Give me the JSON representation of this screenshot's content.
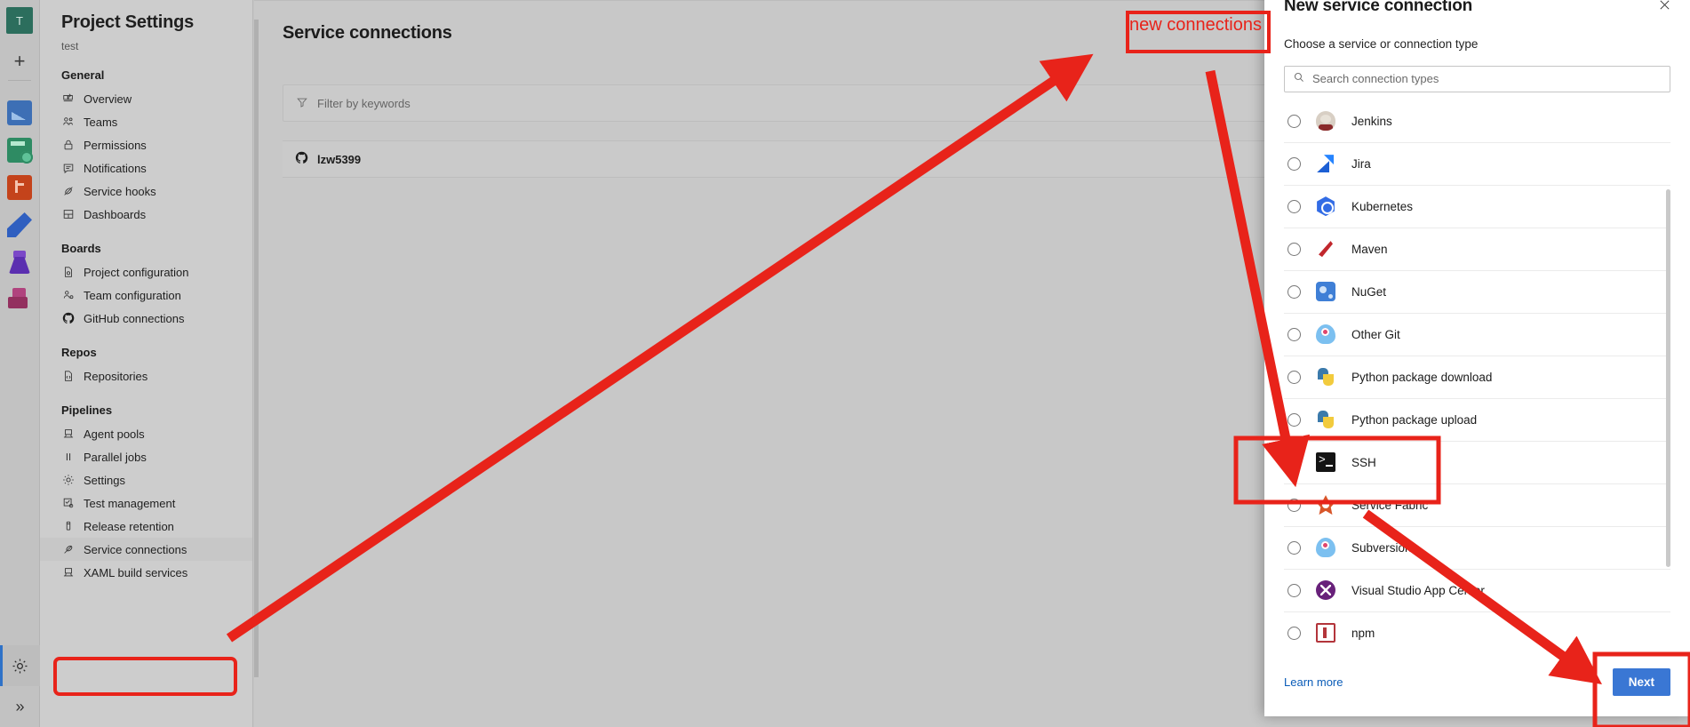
{
  "rail": {
    "org_initial": "T",
    "items": [
      {
        "name": "create-new-icon",
        "label": "+"
      },
      {
        "name": "overview-icon",
        "label": "Overview"
      },
      {
        "name": "boards-icon",
        "label": "Boards"
      },
      {
        "name": "repos-icon",
        "label": "Repos"
      },
      {
        "name": "pipelines-icon",
        "label": "Pipelines"
      },
      {
        "name": "test-plans-icon",
        "label": "Test Plans"
      },
      {
        "name": "artifacts-icon",
        "label": "Artifacts"
      }
    ],
    "settings_label": "Project settings",
    "expand_label": "Expand"
  },
  "nav": {
    "title": "Project Settings",
    "subtitle": "test",
    "groups": [
      {
        "label": "General",
        "items": [
          {
            "label": "Overview",
            "icon": "overview-icon"
          },
          {
            "label": "Teams",
            "icon": "teams-icon"
          },
          {
            "label": "Permissions",
            "icon": "lock-icon"
          },
          {
            "label": "Notifications",
            "icon": "notification-icon"
          },
          {
            "label": "Service hooks",
            "icon": "service-hooks-icon"
          },
          {
            "label": "Dashboards",
            "icon": "dashboards-icon"
          }
        ]
      },
      {
        "label": "Boards",
        "items": [
          {
            "label": "Project configuration",
            "icon": "project-configuration-icon"
          },
          {
            "label": "Team configuration",
            "icon": "team-configuration-icon"
          },
          {
            "label": "GitHub connections",
            "icon": "github-icon"
          }
        ]
      },
      {
        "label": "Repos",
        "items": [
          {
            "label": "Repositories",
            "icon": "repositories-icon"
          }
        ]
      },
      {
        "label": "Pipelines",
        "items": [
          {
            "label": "Agent pools",
            "icon": "agent-pools-icon"
          },
          {
            "label": "Parallel jobs",
            "icon": "parallel-jobs-icon"
          },
          {
            "label": "Settings",
            "icon": "gear-icon"
          },
          {
            "label": "Test management",
            "icon": "test-management-icon"
          },
          {
            "label": "Release retention",
            "icon": "release-retention-icon"
          },
          {
            "label": "Service connections",
            "icon": "service-connections-icon"
          },
          {
            "label": "XAML build services",
            "icon": "xaml-build-services-icon"
          }
        ]
      }
    ]
  },
  "main": {
    "title": "Service connections",
    "filter_placeholder": "Filter by keywords",
    "filter_icon": "filter-icon",
    "connections": [
      {
        "name": "lzw5399",
        "icon": "github-icon"
      }
    ]
  },
  "dialog": {
    "title": "New service connection",
    "close_icon": "close-icon",
    "subtitle": "Choose a service or connection type",
    "search_placeholder": "Search connection types",
    "search_icon": "search-icon",
    "options": [
      {
        "label": "Jenkins",
        "icon": "jenkins-icon",
        "selected": false
      },
      {
        "label": "Jira",
        "icon": "jira-icon",
        "selected": false
      },
      {
        "label": "Kubernetes",
        "icon": "kubernetes-icon",
        "selected": false
      },
      {
        "label": "Maven",
        "icon": "maven-icon",
        "selected": false
      },
      {
        "label": "NuGet",
        "icon": "nuget-icon",
        "selected": false
      },
      {
        "label": "Other Git",
        "icon": "other-git-icon",
        "selected": false
      },
      {
        "label": "Python package download",
        "icon": "python-icon",
        "selected": false
      },
      {
        "label": "Python package upload",
        "icon": "python-icon",
        "selected": false
      },
      {
        "label": "SSH",
        "icon": "ssh-icon",
        "selected": true
      },
      {
        "label": "Service Fabric",
        "icon": "service-fabric-icon",
        "selected": false
      },
      {
        "label": "Subversion",
        "icon": "subversion-icon",
        "selected": false
      },
      {
        "label": "Visual Studio App Center",
        "icon": "visual-studio-app-center-icon",
        "selected": false
      },
      {
        "label": "npm",
        "icon": "npm-icon",
        "selected": false
      }
    ],
    "learn_more": "Learn more",
    "next_label": "Next"
  },
  "annotations": {
    "callout_text": "new connections",
    "accent_color": "#e8231a"
  }
}
